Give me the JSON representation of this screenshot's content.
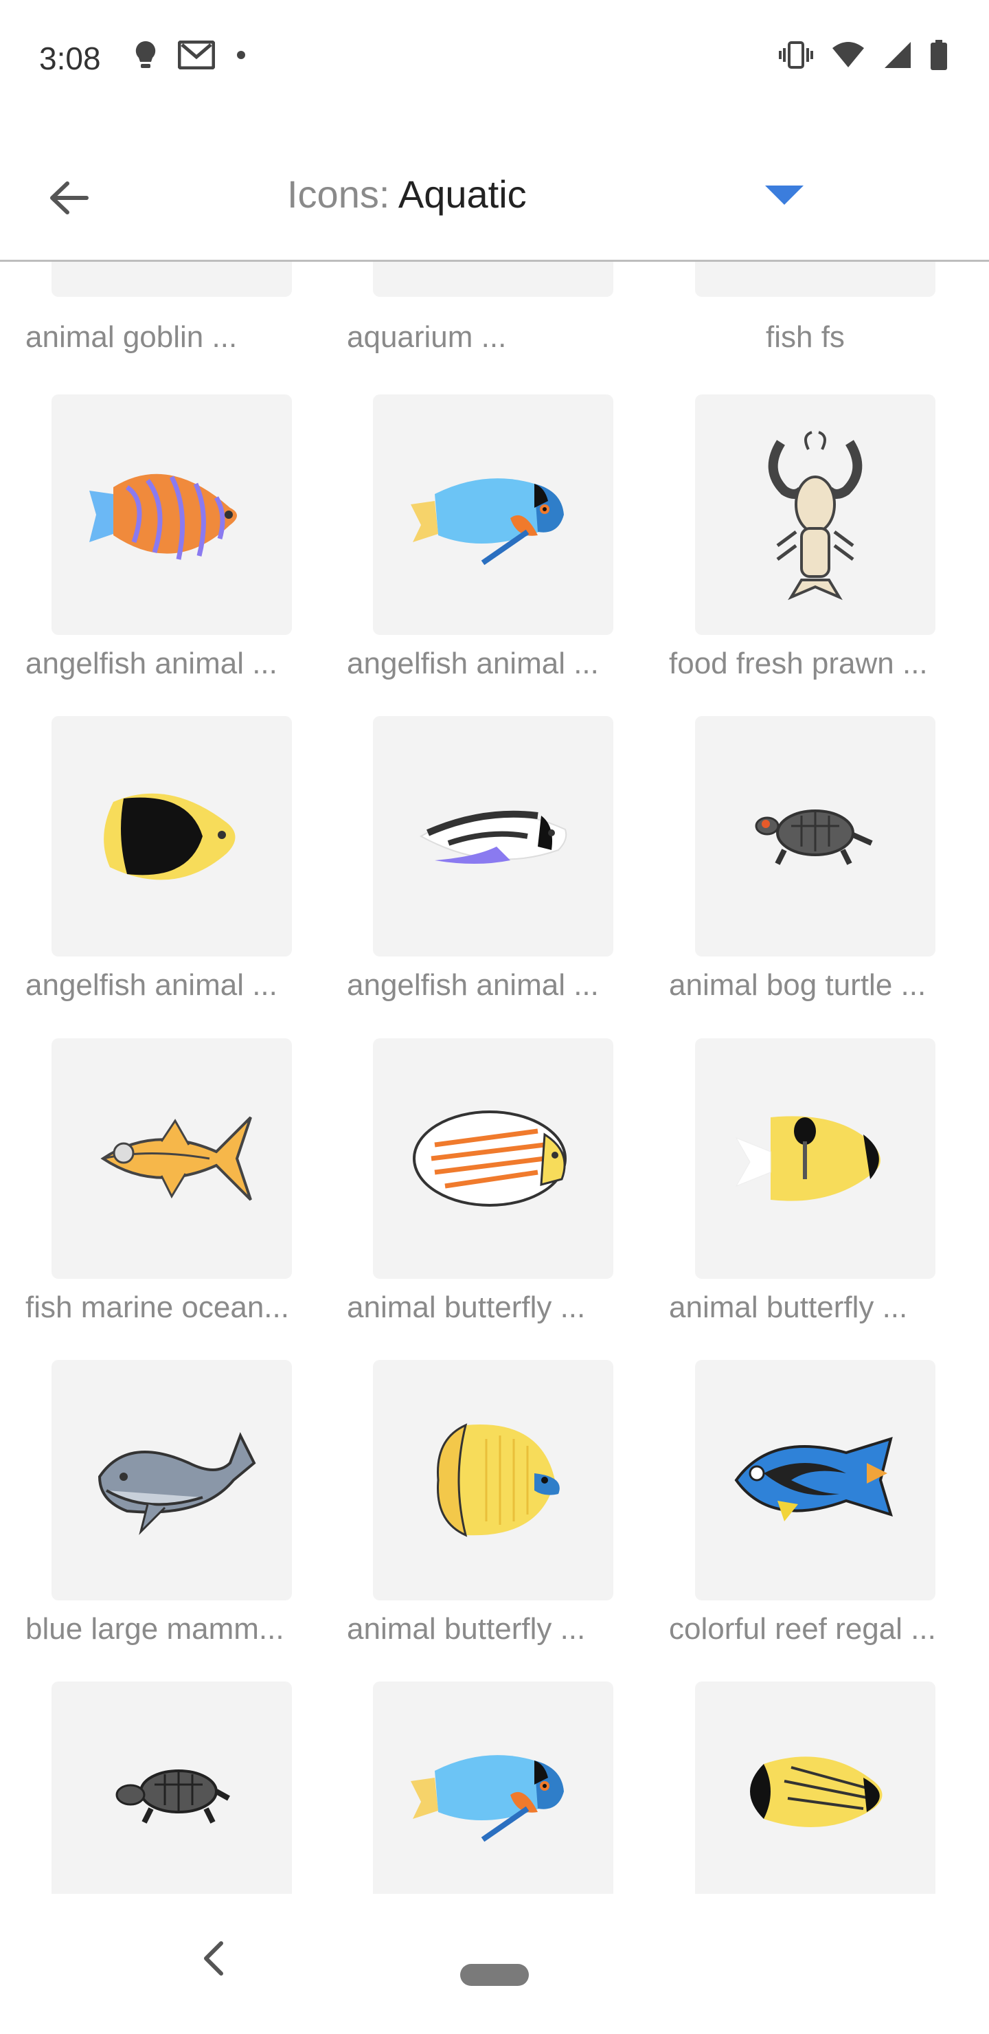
{
  "status": {
    "time": "3:08"
  },
  "toolbar": {
    "title_prefix": "Icons:",
    "category": "Aquatic"
  },
  "grid": {
    "row0_labels": [
      "animal goblin ...",
      "aquarium ...",
      "fish  fs"
    ],
    "items": [
      {
        "label": "angelfish animal ...",
        "icon": "angelfish-icon"
      },
      {
        "label": "angelfish animal ...",
        "icon": "angelfish-icon"
      },
      {
        "label": "food fresh prawn ...",
        "icon": "prawn-icon"
      },
      {
        "label": "angelfish animal ...",
        "icon": "angelfish-icon"
      },
      {
        "label": "angelfish animal ...",
        "icon": "angelfish-icon"
      },
      {
        "label": "animal bog turtle ...",
        "icon": "turtle-icon"
      },
      {
        "label": "fish marine ocean...",
        "icon": "tuna-icon"
      },
      {
        "label": "animal butterfly ...",
        "icon": "butterflyfish-icon"
      },
      {
        "label": "animal butterfly ...",
        "icon": "butterflyfish-icon"
      },
      {
        "label": "blue large mamm...",
        "icon": "whale-icon"
      },
      {
        "label": "animal butterfly ...",
        "icon": "butterflyfish-icon"
      },
      {
        "label": "colorful reef regal ...",
        "icon": "regal-tang-icon"
      }
    ]
  },
  "colors": {
    "accent": "#3b7ddd",
    "tile": "#f3f3f3",
    "label": "#8a8a8a"
  }
}
